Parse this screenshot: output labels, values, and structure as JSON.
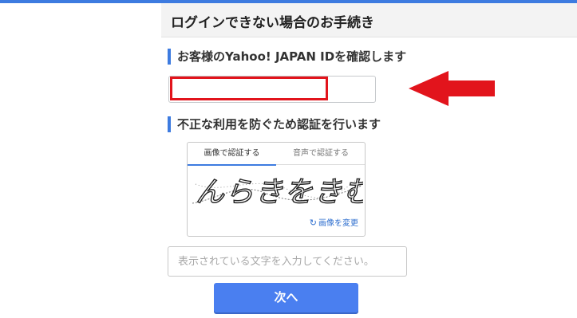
{
  "header": {
    "title": "ログインできない場合のお手続き"
  },
  "section_id": {
    "heading": "お客様のYahoo! JAPAN IDを確認します"
  },
  "id_input": {
    "value": ""
  },
  "section_captcha": {
    "heading": "不正な利用を防ぐため認証を行います"
  },
  "captcha": {
    "tabs": [
      {
        "label": "画像で認証する",
        "active": true
      },
      {
        "label": "音声で認証する",
        "active": false
      }
    ],
    "image_text": "んらきをきむ",
    "refresh_label": "画像を変更",
    "refresh_icon": "refresh-icon"
  },
  "answer_input": {
    "placeholder": "表示されている文字を入力してください。",
    "value": ""
  },
  "next_button": {
    "label": "次へ"
  },
  "colors": {
    "accent": "#3d7be0",
    "button": "#4a7ff0",
    "highlight": "#e2141c"
  }
}
